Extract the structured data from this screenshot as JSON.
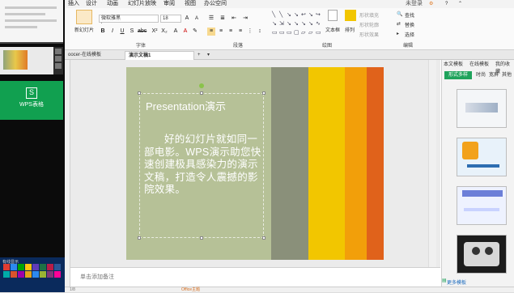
{
  "menubar": {
    "items": [
      "插入",
      "设计",
      "动画",
      "幻灯片放映",
      "审阅",
      "视图",
      "办公空间"
    ],
    "account": "未登录"
  },
  "ribbon": {
    "new_slide": "新幻灯片",
    "font_name": "微软雅黑",
    "font_size": "18",
    "font_group": "字体",
    "paragraph_group": "段落",
    "textbox": "文本框",
    "arrange": "排列",
    "shape_fill": "形状填充",
    "shape_outline": "形状轮廓",
    "shape_effect": "形状效果",
    "drawing_group": "绘图",
    "find": "查找",
    "replace": "替换",
    "select": "选择",
    "edit_group": "编辑"
  },
  "tabs": {
    "prev_doc": "oocer-在线模板",
    "active_doc": "演示文稿1",
    "add": "+"
  },
  "slide": {
    "title": "Presentation演示",
    "body": "好的幻灯片就如同一部电影。WPS演示助您快速创建极具感染力的演示文稿，打造令人震撼的影院效果。"
  },
  "notes": {
    "placeholder": "单击添加备注"
  },
  "status": {
    "page": "1/8",
    "theme": "Office主题"
  },
  "taskpane": {
    "tabs": [
      "本文模板",
      "在线模板",
      "我的收藏"
    ],
    "active_filter": "形式多样",
    "filters": [
      "时尚",
      "宽屏",
      "其他"
    ],
    "more": "更多模板"
  },
  "sidebar": {
    "wps_app": "WPS表格",
    "start_label": "有线显示"
  },
  "colors": {
    "slide_bg": "#b6c197",
    "stripe1": "#8a907a",
    "stripe2": "#f2c600",
    "stripe3": "#f29f0a",
    "stripe4": "#e87a1c",
    "stripe5": "#d95d1a",
    "wps_green": "#11a050"
  }
}
